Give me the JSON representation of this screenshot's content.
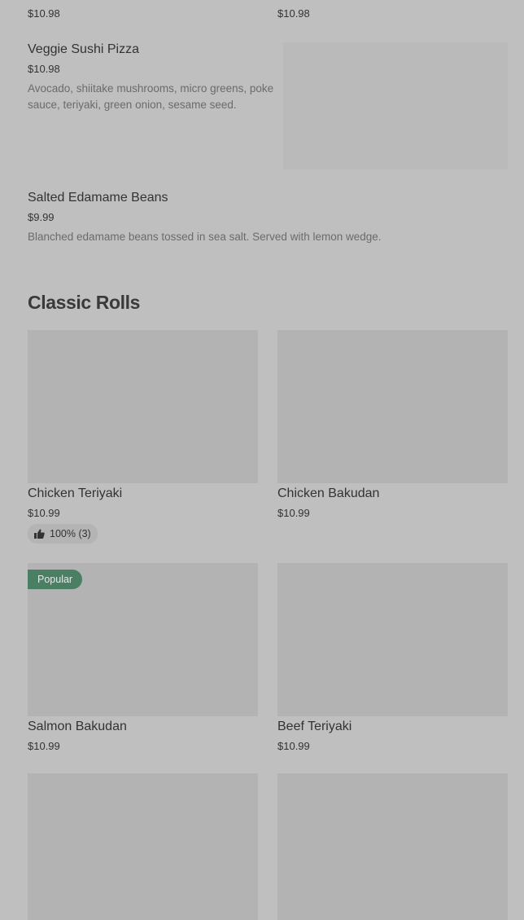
{
  "top_row": [
    {
      "price": "$10.98"
    },
    {
      "price": "$10.98"
    }
  ],
  "items": [
    {
      "name": "Veggie Sushi Pizza",
      "price": "$10.98",
      "description": "Avocado, shiitake mushrooms, micro greens, poke sauce, teriyaki, green onion, sesame seed."
    },
    {
      "name": "Salted Edamame Beans",
      "price": "$9.99",
      "description": "Blanched edamame beans tossed in sea salt. Served with lemon wedge."
    }
  ],
  "section": {
    "title": "Classic Rolls"
  },
  "classic_rolls": [
    {
      "name": "Chicken Teriyaki",
      "price": "$10.99",
      "rating": "100% (3)"
    },
    {
      "name": "Chicken Bakudan",
      "price": "$10.99"
    },
    {
      "name": "Salmon Bakudan",
      "price": "$10.99",
      "badge": "Popular"
    },
    {
      "name": "Beef Teriyaki",
      "price": "$10.99"
    }
  ],
  "icons": {
    "rating": "thumbs-up-icon"
  },
  "colors": {
    "background": "#bfbfbf",
    "image_placeholder": "#b3b3b3",
    "badge": "#4a7f63"
  }
}
